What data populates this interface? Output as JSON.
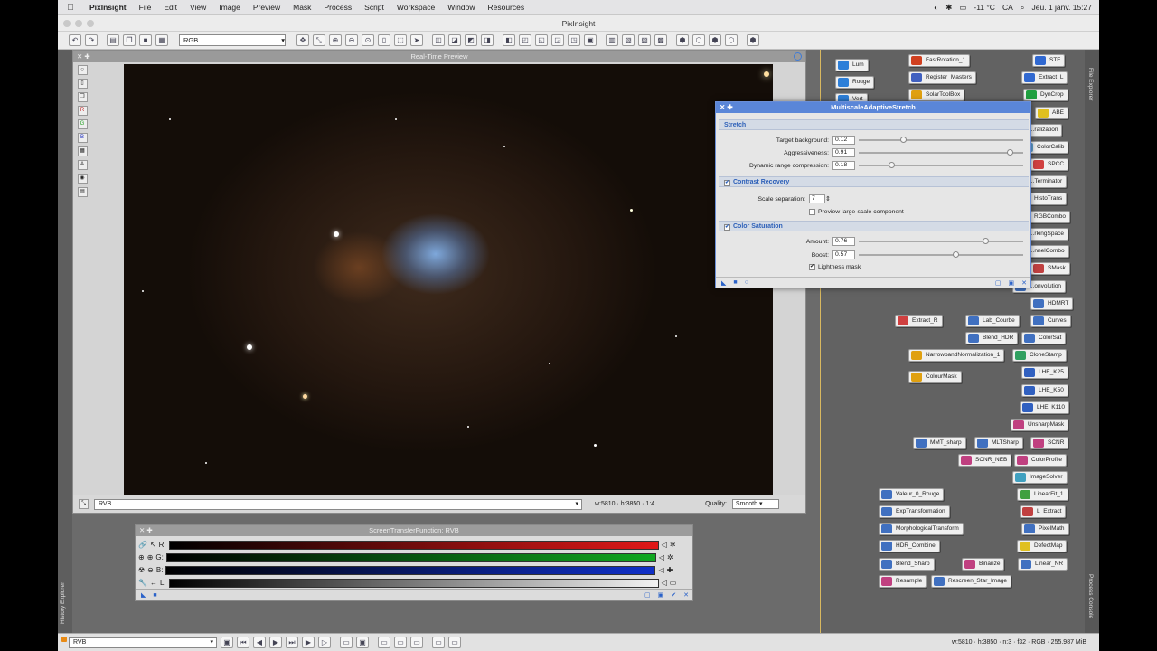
{
  "menubar": {
    "app": "PixInsight",
    "items": [
      "File",
      "Edit",
      "View",
      "Image",
      "Preview",
      "Mask",
      "Process",
      "Script",
      "Workspace",
      "Window",
      "Resources"
    ],
    "temperature": "-11 °C",
    "input": "CA",
    "datetime": "Jeu. 1 janv. 15:27"
  },
  "window": {
    "title": "PixInsight"
  },
  "toolbar": {
    "color_space": "RGB"
  },
  "preview": {
    "title": "Real-Time Preview",
    "view_select": "RVB",
    "dims": "w:5810 · h:3850 · 1:4",
    "quality_label": "Quality:",
    "quality_value": "Smooth"
  },
  "stf": {
    "title": "ScreenTransferFunction: RVB",
    "channels": [
      "R:",
      "G:",
      "B:",
      "L:"
    ],
    "colors": [
      "#e11818",
      "#10a820",
      "#1030c8",
      "#f2f2f2"
    ]
  },
  "mas": {
    "title": "MultiscaleAdaptiveStretch",
    "stretch_section": "Stretch",
    "target_bg_label": "Target background:",
    "target_bg": "0.12",
    "aggr_label": "Aggressiveness:",
    "aggr": "0.91",
    "drc_label": "Dynamic range compression:",
    "drc": "0.18",
    "contrast_section": "Contrast Recovery",
    "scale_sep_label": "Scale separation:",
    "scale_sep": "7",
    "preview_large": "Preview large-scale component",
    "color_section": "Color Saturation",
    "amount_label": "Amount:",
    "amount": "0.76",
    "boost_label": "Boost:",
    "boost": "0.57",
    "lightness": "Lightness mask"
  },
  "process_icons": [
    {
      "label": "Lum",
      "color": "#2d7fd8"
    },
    {
      "label": "Rouge",
      "color": "#2d7fd8"
    },
    {
      "label": "Vert",
      "color": "#2d7fd8"
    },
    {
      "label": "FastRotation_1",
      "color": "#d04020"
    },
    {
      "label": "Register_Masters",
      "color": "#4060c0"
    },
    {
      "label": "SolarToolBox",
      "color": "#e0a010"
    },
    {
      "label": "STF",
      "color": "#3068d0"
    },
    {
      "label": "Extract_L",
      "color": "#3068d0"
    },
    {
      "label": "DynCrop",
      "color": "#20a040"
    },
    {
      "label": "ABE",
      "color": "#e0c020"
    },
    {
      "label": "...ralization",
      "color": "#60a0d0"
    },
    {
      "label": "ColorCalib",
      "color": "#60a0d0"
    },
    {
      "label": "SPCC",
      "color": "#d04040"
    },
    {
      "label": "...Terminator",
      "color": "#30a030"
    },
    {
      "label": "HistoTrans",
      "color": "#4070c0"
    },
    {
      "label": "RGBCombo",
      "color": "#c04040"
    },
    {
      "label": "...rkingSpace",
      "color": "#c04040"
    },
    {
      "label": "...nnelCombo",
      "color": "#c04040"
    },
    {
      "label": "SMask",
      "color": "#c04040"
    },
    {
      "label": "...onvolution",
      "color": "#4070c0"
    },
    {
      "label": "HDMRT",
      "color": "#4070c0"
    },
    {
      "label": "Extract_R",
      "color": "#d04040"
    },
    {
      "label": "Lab_Courbe",
      "color": "#4070c0"
    },
    {
      "label": "Curves",
      "color": "#4070c0"
    },
    {
      "label": "Blend_HDR",
      "color": "#4070c0"
    },
    {
      "label": "ColorSat",
      "color": "#4070c0"
    },
    {
      "label": "NarrowbandNormalization_1",
      "color": "#e0a010"
    },
    {
      "label": "CloneStamp",
      "color": "#30a060"
    },
    {
      "label": "ColourMask",
      "color": "#e0a010"
    },
    {
      "label": "LHE_K25",
      "color": "#3060c0"
    },
    {
      "label": "LHE_K50",
      "color": "#3060c0"
    },
    {
      "label": "LHE_K110",
      "color": "#3060c0"
    },
    {
      "label": "UnsharpMask",
      "color": "#c04080"
    },
    {
      "label": "MMT_sharp",
      "color": "#4070c0"
    },
    {
      "label": "MLTSharp",
      "color": "#4070c0"
    },
    {
      "label": "SCNR",
      "color": "#c04080"
    },
    {
      "label": "SCNR_NEB",
      "color": "#c04080"
    },
    {
      "label": "ColorProfile",
      "color": "#c04080"
    },
    {
      "label": "ImageSolver",
      "color": "#40a0c0"
    },
    {
      "label": "Valeur_0_Rouge",
      "color": "#4070c0"
    },
    {
      "label": "LinearFit_1",
      "color": "#40a040"
    },
    {
      "label": "ExpTransformation",
      "color": "#4070c0"
    },
    {
      "label": "L_Extract",
      "color": "#c04040"
    },
    {
      "label": "MorphologicalTransform",
      "color": "#4070c0"
    },
    {
      "label": "PixelMath",
      "color": "#4070c0"
    },
    {
      "label": "HDR_Combine",
      "color": "#4070c0"
    },
    {
      "label": "DefectMap",
      "color": "#e0c020"
    },
    {
      "label": "Blend_Sharp",
      "color": "#4070c0"
    },
    {
      "label": "Binarize",
      "color": "#c04080"
    },
    {
      "label": "Linear_NR",
      "color": "#4070c0"
    },
    {
      "label": "Resample",
      "color": "#c04080"
    },
    {
      "label": "Rescreen_Star_Image",
      "color": "#4070c0"
    }
  ],
  "sidebar": {
    "history_tab": "History Explorer",
    "file_tab": "File Explorer",
    "console_tab": "Process Console"
  },
  "status": {
    "view": "RVB",
    "info": "w:5810 · h:3850 · n:3 · f32 · RGB · 255.987 MiB"
  }
}
